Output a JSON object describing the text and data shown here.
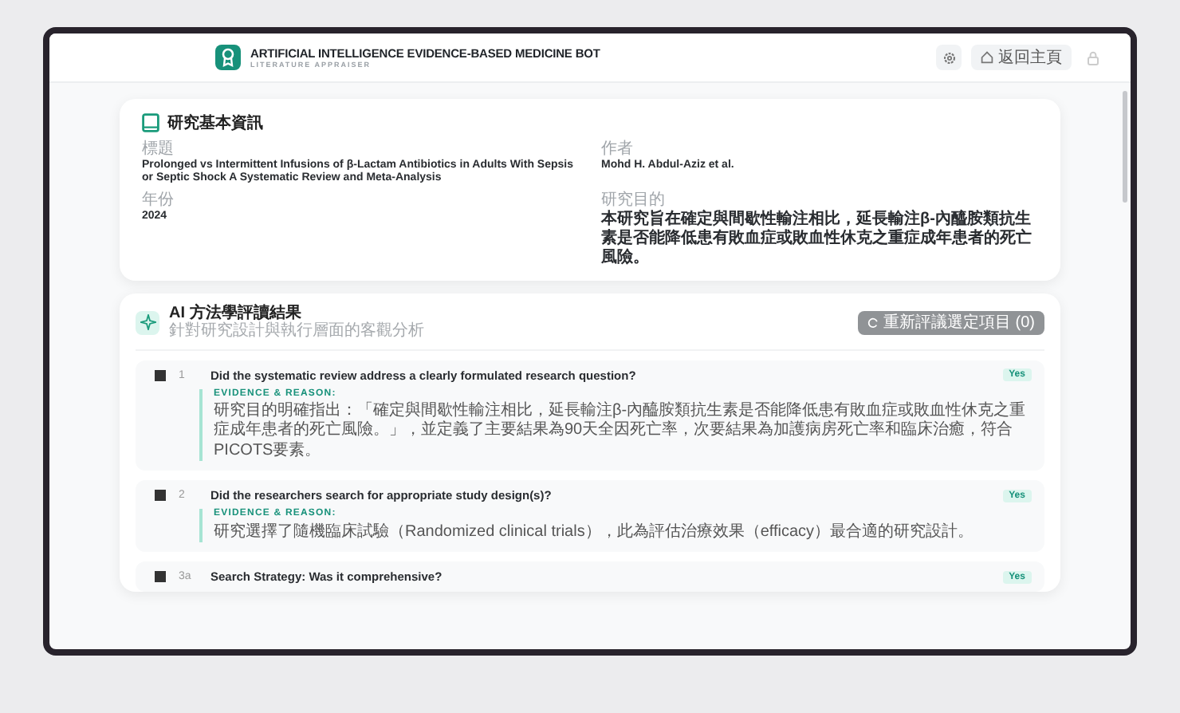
{
  "header": {
    "title": "ARTIFICIAL INTELLIGENCE EVIDENCE-BASED MEDICINE BOT",
    "subtitle": "LITERATURE APPRAISER",
    "home_button": "返回主頁"
  },
  "study_info": {
    "heading": "研究基本資訊",
    "fields": [
      {
        "label": "標題",
        "value": "Prolonged vs Intermittent Infusions of β-Lactam Antibiotics in Adults With Sepsis or Septic Shock A Systematic Review and Meta-Analysis"
      },
      {
        "label": "作者",
        "value": "Mohd H. Abdul-Aziz et al."
      },
      {
        "label": "年份",
        "value": "2024"
      },
      {
        "label": "研究目的",
        "value": "本研究旨在確定與間歇性輸注相比，延長輸注β-內醯胺類抗生素是否能降低患有敗血症或敗血性休克之重症成年患者的死亡風險。"
      }
    ]
  },
  "appraisal": {
    "heading": "AI 方法學評讀結果",
    "subheading": "針對研究設計與執行層面的客觀分析",
    "reappraise_button": "重新評議選定項目 (0)",
    "items": [
      {
        "checked": false,
        "number": "1",
        "question": "Did the systematic review address a clearly formulated research question?",
        "answer": "Yes",
        "evidence_label": "EVIDENCE & REASON:",
        "evidence": "研究目的明確指出：「確定與間歇性輸注相比，延長輸注β-內醯胺類抗生素是否能降低患有敗血症或敗血性休克之重症成年患者的死亡風險。」，並定義了主要結果為90天全因死亡率，次要結果為加護病房死亡率和臨床治癒，符合PICOTS要素。"
      },
      {
        "checked": false,
        "number": "2",
        "question": "Did the researchers search for appropriate study design(s)?",
        "answer": "Yes",
        "evidence_label": "EVIDENCE & REASON:",
        "evidence": "研究選擇了隨機臨床試驗（Randomized clinical trials），此為評估治療效果（efficacy）最合適的研究設計。"
      },
      {
        "checked": false,
        "number": "3a",
        "question": "Search Strategy: Was it comprehensive?",
        "answer": "Yes"
      }
    ]
  }
}
